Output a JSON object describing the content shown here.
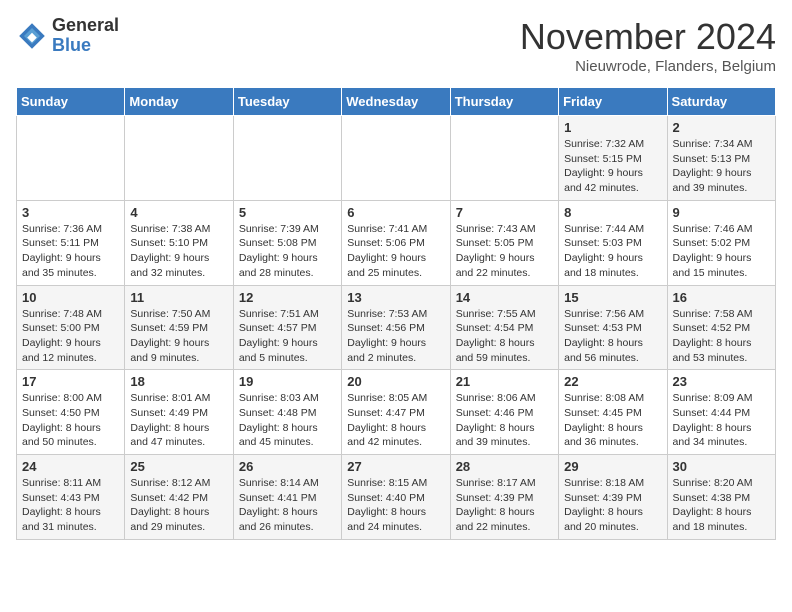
{
  "header": {
    "logo_general": "General",
    "logo_blue": "Blue",
    "title": "November 2024",
    "location": "Nieuwrode, Flanders, Belgium"
  },
  "weekdays": [
    "Sunday",
    "Monday",
    "Tuesday",
    "Wednesday",
    "Thursday",
    "Friday",
    "Saturday"
  ],
  "weeks": [
    [
      {
        "day": "",
        "sunrise": "",
        "sunset": "",
        "daylight": ""
      },
      {
        "day": "",
        "sunrise": "",
        "sunset": "",
        "daylight": ""
      },
      {
        "day": "",
        "sunrise": "",
        "sunset": "",
        "daylight": ""
      },
      {
        "day": "",
        "sunrise": "",
        "sunset": "",
        "daylight": ""
      },
      {
        "day": "",
        "sunrise": "",
        "sunset": "",
        "daylight": ""
      },
      {
        "day": "1",
        "sunrise": "Sunrise: 7:32 AM",
        "sunset": "Sunset: 5:15 PM",
        "daylight": "Daylight: 9 hours and 42 minutes."
      },
      {
        "day": "2",
        "sunrise": "Sunrise: 7:34 AM",
        "sunset": "Sunset: 5:13 PM",
        "daylight": "Daylight: 9 hours and 39 minutes."
      }
    ],
    [
      {
        "day": "3",
        "sunrise": "Sunrise: 7:36 AM",
        "sunset": "Sunset: 5:11 PM",
        "daylight": "Daylight: 9 hours and 35 minutes."
      },
      {
        "day": "4",
        "sunrise": "Sunrise: 7:38 AM",
        "sunset": "Sunset: 5:10 PM",
        "daylight": "Daylight: 9 hours and 32 minutes."
      },
      {
        "day": "5",
        "sunrise": "Sunrise: 7:39 AM",
        "sunset": "Sunset: 5:08 PM",
        "daylight": "Daylight: 9 hours and 28 minutes."
      },
      {
        "day": "6",
        "sunrise": "Sunrise: 7:41 AM",
        "sunset": "Sunset: 5:06 PM",
        "daylight": "Daylight: 9 hours and 25 minutes."
      },
      {
        "day": "7",
        "sunrise": "Sunrise: 7:43 AM",
        "sunset": "Sunset: 5:05 PM",
        "daylight": "Daylight: 9 hours and 22 minutes."
      },
      {
        "day": "8",
        "sunrise": "Sunrise: 7:44 AM",
        "sunset": "Sunset: 5:03 PM",
        "daylight": "Daylight: 9 hours and 18 minutes."
      },
      {
        "day": "9",
        "sunrise": "Sunrise: 7:46 AM",
        "sunset": "Sunset: 5:02 PM",
        "daylight": "Daylight: 9 hours and 15 minutes."
      }
    ],
    [
      {
        "day": "10",
        "sunrise": "Sunrise: 7:48 AM",
        "sunset": "Sunset: 5:00 PM",
        "daylight": "Daylight: 9 hours and 12 minutes."
      },
      {
        "day": "11",
        "sunrise": "Sunrise: 7:50 AM",
        "sunset": "Sunset: 4:59 PM",
        "daylight": "Daylight: 9 hours and 9 minutes."
      },
      {
        "day": "12",
        "sunrise": "Sunrise: 7:51 AM",
        "sunset": "Sunset: 4:57 PM",
        "daylight": "Daylight: 9 hours and 5 minutes."
      },
      {
        "day": "13",
        "sunrise": "Sunrise: 7:53 AM",
        "sunset": "Sunset: 4:56 PM",
        "daylight": "Daylight: 9 hours and 2 minutes."
      },
      {
        "day": "14",
        "sunrise": "Sunrise: 7:55 AM",
        "sunset": "Sunset: 4:54 PM",
        "daylight": "Daylight: 8 hours and 59 minutes."
      },
      {
        "day": "15",
        "sunrise": "Sunrise: 7:56 AM",
        "sunset": "Sunset: 4:53 PM",
        "daylight": "Daylight: 8 hours and 56 minutes."
      },
      {
        "day": "16",
        "sunrise": "Sunrise: 7:58 AM",
        "sunset": "Sunset: 4:52 PM",
        "daylight": "Daylight: 8 hours and 53 minutes."
      }
    ],
    [
      {
        "day": "17",
        "sunrise": "Sunrise: 8:00 AM",
        "sunset": "Sunset: 4:50 PM",
        "daylight": "Daylight: 8 hours and 50 minutes."
      },
      {
        "day": "18",
        "sunrise": "Sunrise: 8:01 AM",
        "sunset": "Sunset: 4:49 PM",
        "daylight": "Daylight: 8 hours and 47 minutes."
      },
      {
        "day": "19",
        "sunrise": "Sunrise: 8:03 AM",
        "sunset": "Sunset: 4:48 PM",
        "daylight": "Daylight: 8 hours and 45 minutes."
      },
      {
        "day": "20",
        "sunrise": "Sunrise: 8:05 AM",
        "sunset": "Sunset: 4:47 PM",
        "daylight": "Daylight: 8 hours and 42 minutes."
      },
      {
        "day": "21",
        "sunrise": "Sunrise: 8:06 AM",
        "sunset": "Sunset: 4:46 PM",
        "daylight": "Daylight: 8 hours and 39 minutes."
      },
      {
        "day": "22",
        "sunrise": "Sunrise: 8:08 AM",
        "sunset": "Sunset: 4:45 PM",
        "daylight": "Daylight: 8 hours and 36 minutes."
      },
      {
        "day": "23",
        "sunrise": "Sunrise: 8:09 AM",
        "sunset": "Sunset: 4:44 PM",
        "daylight": "Daylight: 8 hours and 34 minutes."
      }
    ],
    [
      {
        "day": "24",
        "sunrise": "Sunrise: 8:11 AM",
        "sunset": "Sunset: 4:43 PM",
        "daylight": "Daylight: 8 hours and 31 minutes."
      },
      {
        "day": "25",
        "sunrise": "Sunrise: 8:12 AM",
        "sunset": "Sunset: 4:42 PM",
        "daylight": "Daylight: 8 hours and 29 minutes."
      },
      {
        "day": "26",
        "sunrise": "Sunrise: 8:14 AM",
        "sunset": "Sunset: 4:41 PM",
        "daylight": "Daylight: 8 hours and 26 minutes."
      },
      {
        "day": "27",
        "sunrise": "Sunrise: 8:15 AM",
        "sunset": "Sunset: 4:40 PM",
        "daylight": "Daylight: 8 hours and 24 minutes."
      },
      {
        "day": "28",
        "sunrise": "Sunrise: 8:17 AM",
        "sunset": "Sunset: 4:39 PM",
        "daylight": "Daylight: 8 hours and 22 minutes."
      },
      {
        "day": "29",
        "sunrise": "Sunrise: 8:18 AM",
        "sunset": "Sunset: 4:39 PM",
        "daylight": "Daylight: 8 hours and 20 minutes."
      },
      {
        "day": "30",
        "sunrise": "Sunrise: 8:20 AM",
        "sunset": "Sunset: 4:38 PM",
        "daylight": "Daylight: 8 hours and 18 minutes."
      }
    ]
  ]
}
